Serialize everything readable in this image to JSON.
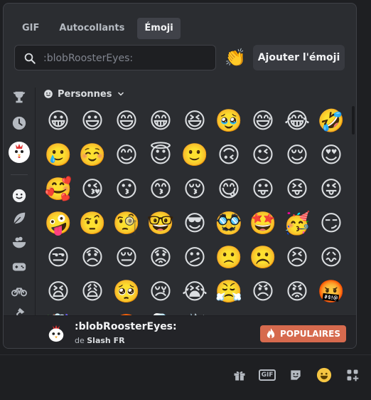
{
  "tabs": [
    {
      "label": "GIF",
      "active": false
    },
    {
      "label": "Autocollants",
      "active": false
    },
    {
      "label": "Émoji",
      "active": true
    }
  ],
  "search": {
    "placeholder": ":blobRoosterEyes:",
    "value": ""
  },
  "preview_emoji": "👏",
  "add_button_label": "Ajouter l'émoji",
  "sidebar": {
    "items": [
      {
        "name": "trophy-icon",
        "symbol": "🏆"
      },
      {
        "name": "recent-clock-icon",
        "symbol": "🕘"
      },
      {
        "name": "server-rooster-icon",
        "symbol": "🐔"
      },
      {
        "name": "people-smiley-icon",
        "symbol": "☺"
      },
      {
        "name": "nature-leaf-icon",
        "symbol": "🍃"
      },
      {
        "name": "food-bowl-icon",
        "symbol": "🍲"
      },
      {
        "name": "activity-gamepad-icon",
        "symbol": "🎮"
      },
      {
        "name": "travel-bike-icon",
        "symbol": "🚲"
      },
      {
        "name": "objects-lamp-icon",
        "symbol": "💡"
      },
      {
        "name": "heart-icon",
        "symbol": "♥"
      }
    ]
  },
  "section": {
    "label": "Personnes"
  },
  "emoji_rows": [
    [
      "😀",
      "😃",
      "😄",
      "😁",
      "😆",
      "🥹",
      "😅",
      "😂",
      "🤣"
    ],
    [
      "🥲",
      "☺️",
      "😊",
      "😇",
      "🙂",
      "🙃",
      "😉",
      "😌",
      "😍"
    ],
    [
      "🥰",
      "😘",
      "😗",
      "😙",
      "😚",
      "😋",
      "😛",
      "😝",
      "😜"
    ],
    [
      "🤪",
      "🤨",
      "🧐",
      "🤓",
      "😎",
      "🥸",
      "🤩",
      "🥳",
      "😏"
    ],
    [
      "😒",
      "😞",
      "😔",
      "😟",
      "😕",
      "🙁",
      "☹️",
      "😣",
      "😖"
    ],
    [
      "😫",
      "😩",
      "🥺",
      "😢",
      "😭",
      "😤",
      "😠",
      "😡",
      "🤬"
    ],
    [
      "🤯",
      "😳",
      "🥵",
      "🥶",
      "😶‍🌫️",
      "😱",
      "😨",
      "😰",
      "😥"
    ]
  ],
  "footer": {
    "emoji_name": ":blobRoosterEyes:",
    "from_prefix": "de",
    "server_name": "Slash FR",
    "badge_label": "POPULAIRES"
  },
  "bottom_bar": {
    "icons": [
      "gift-icon",
      "gif-icon",
      "sticker-icon",
      "emoji-icon",
      "apps-icon"
    ],
    "gif_label": "GIF"
  },
  "colors": {
    "background": "#1e1f22",
    "panel": "#2b2d31",
    "badge": "#d66a4e",
    "accent_yellow": "#f5c542"
  }
}
